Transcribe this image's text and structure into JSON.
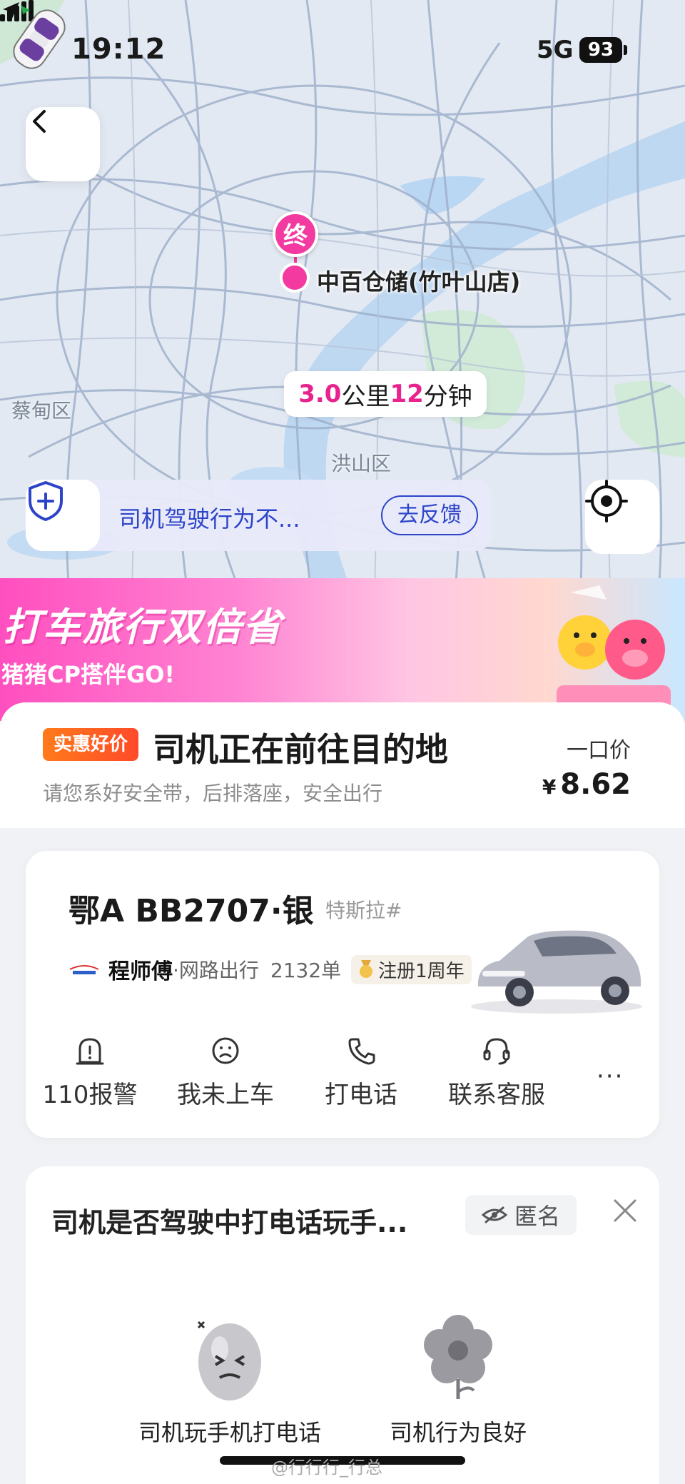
{
  "status_bar": {
    "time": "19:12",
    "network": "5G",
    "battery": "93"
  },
  "map": {
    "end_pin": "终",
    "destination": "中百仓储(竹叶山店)",
    "eta": {
      "distance_value": "3.0",
      "distance_unit": "公里",
      "time_value": "12",
      "time_unit": "分钟"
    },
    "districts": [
      "蔡甸区",
      "洪山区"
    ]
  },
  "safety": {
    "text": "司机驾驶行为不...",
    "feedback_label": "去反馈"
  },
  "promo": {
    "title": "打车旅行双倍省",
    "subtitle": "猪猪CP搭伴GO!"
  },
  "trip": {
    "badge": "实惠好价",
    "title": "司机正在前往目的地",
    "subtitle": "请您系好安全带，后排落座，安全出行",
    "price_label": "一口价",
    "currency": "¥",
    "price": "8.62"
  },
  "driver": {
    "plate": "鄂A BB2707·银",
    "model": "特斯拉#",
    "name": "程师傅",
    "platform": "·网路出行",
    "orders": "2132单",
    "badge": "注册1周年",
    "company_logo_text": "网路出行"
  },
  "actions": [
    {
      "label": "110报警",
      "icon": "alert-icon"
    },
    {
      "label": "我未上车",
      "icon": "sad-face-icon"
    },
    {
      "label": "打电话",
      "icon": "phone-icon"
    },
    {
      "label": "联系客服",
      "icon": "headset-icon"
    }
  ],
  "more_label": "···",
  "survey": {
    "question": "司机是否驾驶中打电话玩手...",
    "anon_label": "匿名",
    "choices": [
      {
        "label": "司机玩手机打电话",
        "icon": "egg-face-icon"
      },
      {
        "label": "司机行为良好",
        "icon": "flower-icon"
      }
    ]
  },
  "watermark": "@行行行_行总"
}
